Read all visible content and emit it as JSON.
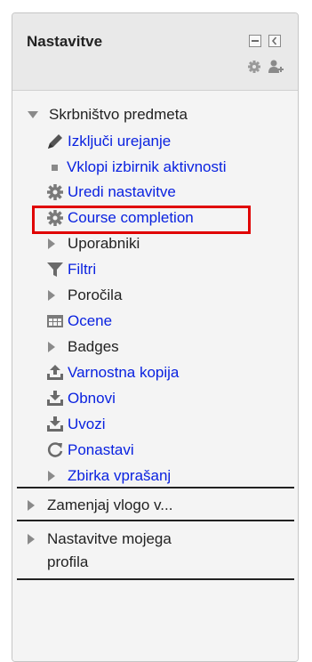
{
  "block": {
    "title": "Nastavitve",
    "header_icons": [
      "minimize-icon",
      "dock-icon",
      "gear-icon",
      "user-add-icon"
    ]
  },
  "items": {
    "course_admin": "Skrbništvo predmeta",
    "turn_editing_off": "Izključi urejanje",
    "activity_chooser": "Vklopi izbirnik aktivnosti",
    "edit_settings": "Uredi nastavitve",
    "course_completion": "Course completion",
    "users": "Uporabniki",
    "filters": "Filtri",
    "reports": "Poročila",
    "grades": "Ocene",
    "badges": "Badges",
    "backup": "Varnostna kopija",
    "restore": "Obnovi",
    "import": "Uvozi",
    "reset": "Ponastavi",
    "question_bank": "Zbirka vprašanj",
    "switch_role": "Zamenjaj vlogo v...",
    "profile_settings_line1": "Nastavitve mojega",
    "profile_settings_line2": "profila"
  },
  "colors": {
    "link": "#0a22e0",
    "highlight": "#e00000",
    "icon": "#7a7a7a"
  }
}
